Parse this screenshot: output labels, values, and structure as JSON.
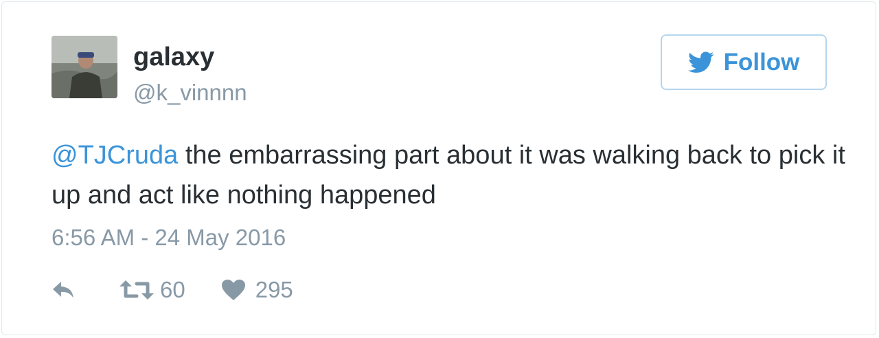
{
  "tweet": {
    "author": {
      "display_name": "galaxy",
      "handle": "@k_vinnnn",
      "avatar_icon": "user-photo-avatar"
    },
    "follow_button": {
      "label": "Follow",
      "icon": "twitter-bird-icon"
    },
    "body": {
      "mention": "@TJCruda",
      "text": " the embarrassing part about it was walking back to pick it up and act like nothing happened"
    },
    "timestamp": "6:56 AM - 24 May 2016",
    "actions": {
      "reply_icon": "reply-icon",
      "retweet_icon": "retweet-icon",
      "retweet_count": "60",
      "like_icon": "heart-icon",
      "like_count": "295"
    }
  },
  "colors": {
    "link": "#3b94d9",
    "text": "#292f33",
    "muted": "#8899a6",
    "border": "#e1e8ed"
  }
}
